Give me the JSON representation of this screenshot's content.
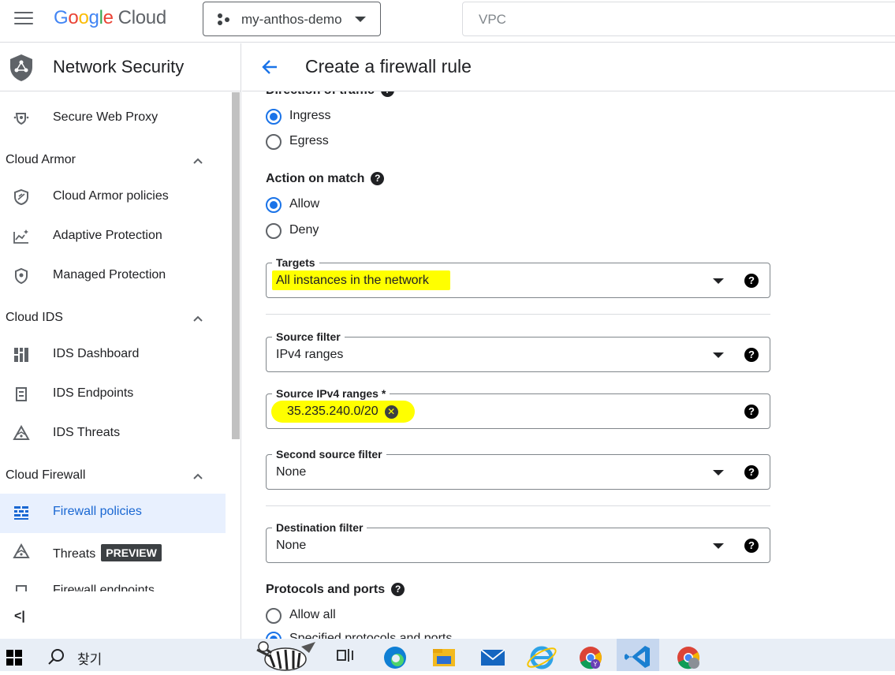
{
  "topbar": {
    "logo_google": "Google",
    "logo_cloud": "Cloud",
    "project_name": "my-anthos-demo",
    "search_placeholder": "VPC"
  },
  "sidebar": {
    "title": "Network Security",
    "items": [
      {
        "label": "Secure Web Proxy",
        "icon": "proxy-icon"
      },
      {
        "section": "Cloud Armor"
      },
      {
        "label": "Cloud Armor policies",
        "icon": "shield-icon"
      },
      {
        "label": "Adaptive Protection",
        "icon": "chart-sparkle-icon"
      },
      {
        "label": "Managed Protection",
        "icon": "protection-icon"
      },
      {
        "section": "Cloud IDS"
      },
      {
        "label": "IDS Dashboard",
        "icon": "dashboard-icon"
      },
      {
        "label": "IDS Endpoints",
        "icon": "endpoint-icon"
      },
      {
        "label": "IDS Threats",
        "icon": "threat-icon"
      },
      {
        "section": "Cloud Firewall"
      },
      {
        "label": "Firewall policies",
        "icon": "firewall-icon",
        "active": true
      },
      {
        "label": "Threats",
        "icon": "threat-icon",
        "badge": "PREVIEW"
      },
      {
        "label": "Firewall endpoints",
        "icon": "endpoint-icon"
      }
    ],
    "collapse_label": "<|"
  },
  "main": {
    "title": "Create a firewall rule",
    "direction": {
      "label": "Direction of traffic",
      "options": [
        "Ingress",
        "Egress"
      ],
      "selected": "Ingress"
    },
    "action": {
      "label": "Action on match",
      "options": [
        "Allow",
        "Deny"
      ],
      "selected": "Allow"
    },
    "targets": {
      "label": "Targets",
      "value": "All instances in the network"
    },
    "source_filter": {
      "label": "Source filter",
      "value": "IPv4 ranges"
    },
    "source_ranges": {
      "label": "Source IPv4 ranges *",
      "chip": "35.235.240.0/20"
    },
    "second_source_filter": {
      "label": "Second source filter",
      "value": "None"
    },
    "destination_filter": {
      "label": "Destination filter",
      "value": "None"
    },
    "protocols": {
      "label": "Protocols and ports",
      "options": [
        "Allow all",
        "Specified protocols and ports"
      ]
    }
  },
  "taskbar": {
    "search_text": "찾기",
    "apps": [
      "task-view-icon",
      "edge-icon",
      "file-explorer-icon",
      "mail-icon",
      "internet-explorer-icon",
      "chrome-icon",
      "vscode-icon",
      "chrome-icon"
    ]
  },
  "colors": {
    "accent": "#1a73e8",
    "active_bg": "#e8f0fe",
    "highlight": "#ffff00"
  }
}
